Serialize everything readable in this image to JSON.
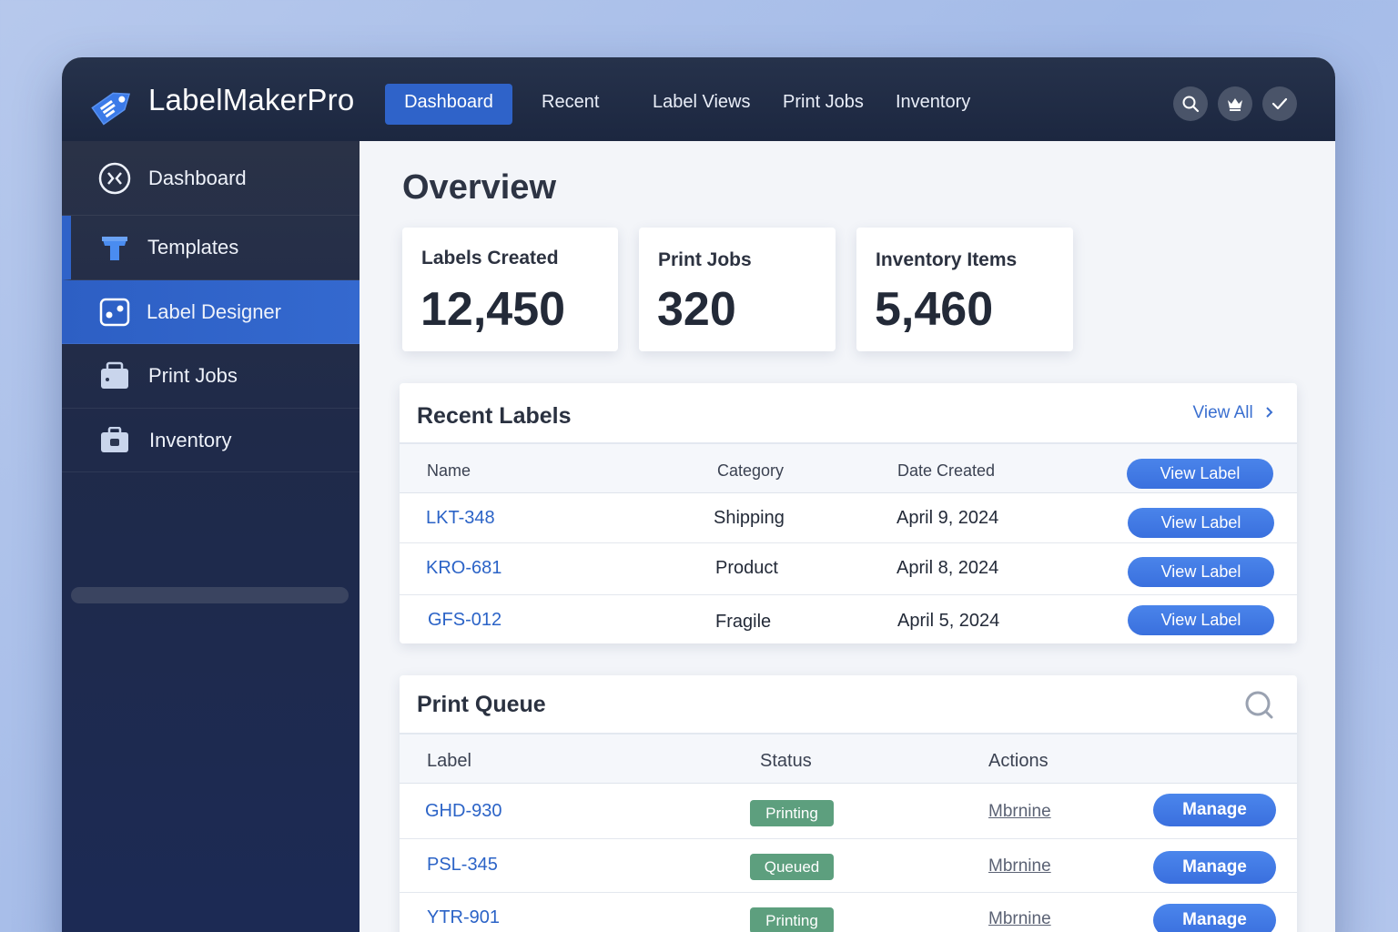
{
  "app": {
    "name": "LabelMakerPro"
  },
  "topnav": {
    "items": [
      "Dashboard",
      "Recent",
      "Label Views",
      "Print Jobs",
      "Inventory"
    ],
    "active": "Dashboard",
    "icons": [
      "search-icon",
      "crown-icon",
      "check-icon"
    ]
  },
  "sidebar": {
    "items": [
      {
        "label": "Dashboard",
        "icon": "dashboard-icon"
      },
      {
        "label": "Templates",
        "icon": "templates-icon"
      },
      {
        "label": "Label Designer",
        "icon": "designer-icon"
      },
      {
        "label": "Print Jobs",
        "icon": "print-jobs-icon"
      },
      {
        "label": "Inventory",
        "icon": "inventory-icon"
      }
    ],
    "active": "Label Designer"
  },
  "overview": {
    "title": "Overview",
    "stats": [
      {
        "label": "Labels Created",
        "value": "12,450"
      },
      {
        "label": "Print Jobs",
        "value": "320"
      },
      {
        "label": "Inventory Items",
        "value": "5,460"
      }
    ]
  },
  "recent_labels": {
    "title": "Recent Labels",
    "view_all": "View All",
    "columns": [
      "Name",
      "Category",
      "Date Created"
    ],
    "header_button": "View Label",
    "rows": [
      {
        "name": "LKT-348",
        "category": "Shipping",
        "date": "April 9, 2024",
        "button": "View Label"
      },
      {
        "name": "KRO-681",
        "category": "Product",
        "date": "April 8, 2024",
        "button": "View Label"
      },
      {
        "name": "GFS-012",
        "category": "Fragile",
        "date": "April 5, 2024",
        "button": "View Label"
      }
    ]
  },
  "print_queue": {
    "title": "Print Queue",
    "columns": [
      "Label",
      "Status",
      "Actions"
    ],
    "rows": [
      {
        "label": "GHD-930",
        "status": "Printing",
        "action": "Mbrnine",
        "button": "Manage"
      },
      {
        "label": "PSL-345",
        "status": "Queued",
        "action": "Mbrnine",
        "button": "Manage"
      },
      {
        "label": "YTR-901",
        "status": "Printing",
        "action": "Mbrnine",
        "button": "Manage"
      }
    ]
  },
  "colors": {
    "accent": "#2f63c9",
    "topbar": "#1f2a43",
    "status_green": "#5d9f7e",
    "link": "#2b63c7"
  }
}
